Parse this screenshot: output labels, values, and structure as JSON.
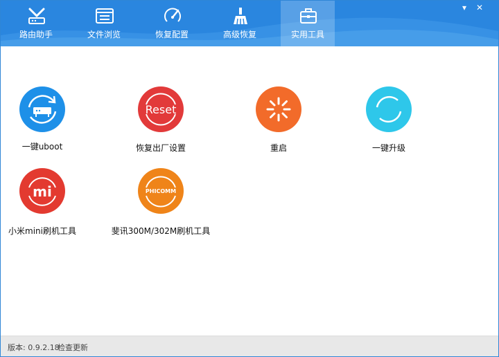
{
  "window": {
    "minimize_glyph": "▾",
    "close_glyph": "✕"
  },
  "tabs": [
    {
      "label": "路由助手",
      "icon": "router-tools-icon"
    },
    {
      "label": "文件浏览",
      "icon": "file-browser-icon"
    },
    {
      "label": "恢复配置",
      "icon": "restore-config-icon"
    },
    {
      "label": "高级恢复",
      "icon": "advanced-restore-icon"
    },
    {
      "label": "实用工具",
      "icon": "toolbox-icon",
      "active": true
    }
  ],
  "tools": [
    {
      "label": "一键uboot",
      "icon": "router-refresh-icon",
      "color": "#1e90e8"
    },
    {
      "label": "恢复出厂设置",
      "icon": "reset-icon",
      "icon_text": "Reset",
      "color": "#e23a3a"
    },
    {
      "label": "重启",
      "icon": "reboot-icon",
      "color": "#f26b2a"
    },
    {
      "label": "一键升级",
      "icon": "upgrade-icon",
      "color": "#2ec7ea"
    },
    {
      "label": "小米mini刷机工具",
      "icon": "xiaomi-logo-icon",
      "icon_text": "mi",
      "color": "#e33a30"
    },
    {
      "label": "斐讯300M/302M刷机工具",
      "icon": "phicomm-logo-icon",
      "icon_text": "PHICOMM",
      "color": "#ef8419"
    }
  ],
  "status": {
    "version": "版本: 0.9.2.18",
    "check_update": "检查更新"
  },
  "colors": {
    "header": "#2a86df",
    "statusbar": "#e8e8e8"
  }
}
